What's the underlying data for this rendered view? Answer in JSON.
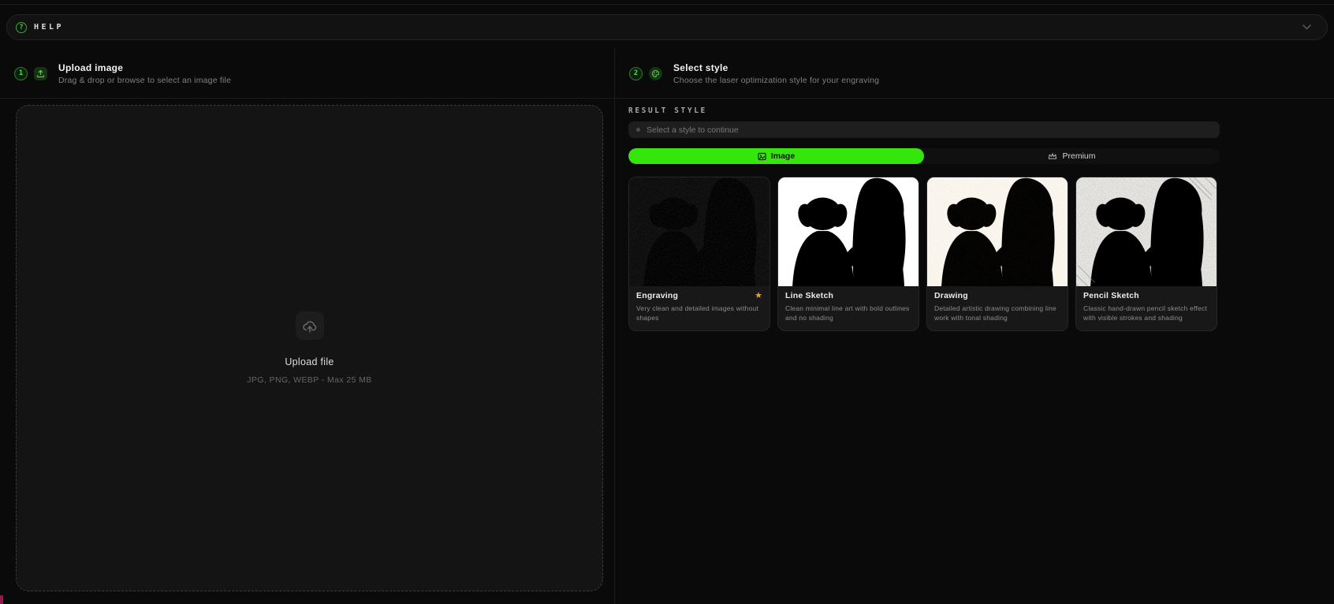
{
  "help_bar": {
    "label": "HELP"
  },
  "steps": {
    "upload": {
      "number": "1",
      "title": "Upload image",
      "subtitle": "Drag & drop or browse to select an image file"
    },
    "style": {
      "number": "2",
      "title": "Select style",
      "subtitle": "Choose the laser optimization style for your engraving"
    }
  },
  "dropzone": {
    "title": "Upload file",
    "formats": "JPG, PNG, WEBP - Max 25 MB"
  },
  "result_style": {
    "label": "RESULT STYLE",
    "placeholder": "Select a style to continue"
  },
  "tabs": [
    {
      "label": "Image",
      "active": true
    },
    {
      "label": "Premium",
      "active": false
    }
  ],
  "styles": [
    {
      "name": "Engraving",
      "description": "Very clean and detailed images without shapes",
      "featured": true
    },
    {
      "name": "Line Sketch",
      "description": "Clean minimal line art with bold outlines and no shading",
      "featured": false
    },
    {
      "name": "Drawing",
      "description": "Detailed artistic drawing combining line work with tonal shading",
      "featured": false
    },
    {
      "name": "Pencil Sketch",
      "description": "Classic hand-drawn pencil sketch effect with visible strokes and shading",
      "featured": false
    }
  ],
  "icons": {
    "star": "★",
    "help": "?"
  },
  "colors": {
    "accent_green": "#35e60d",
    "badge_green": "#4bdc4b",
    "star_orange": "#f0a11a",
    "corner_magenta": "#97174f",
    "background": "#0a0a0a"
  }
}
